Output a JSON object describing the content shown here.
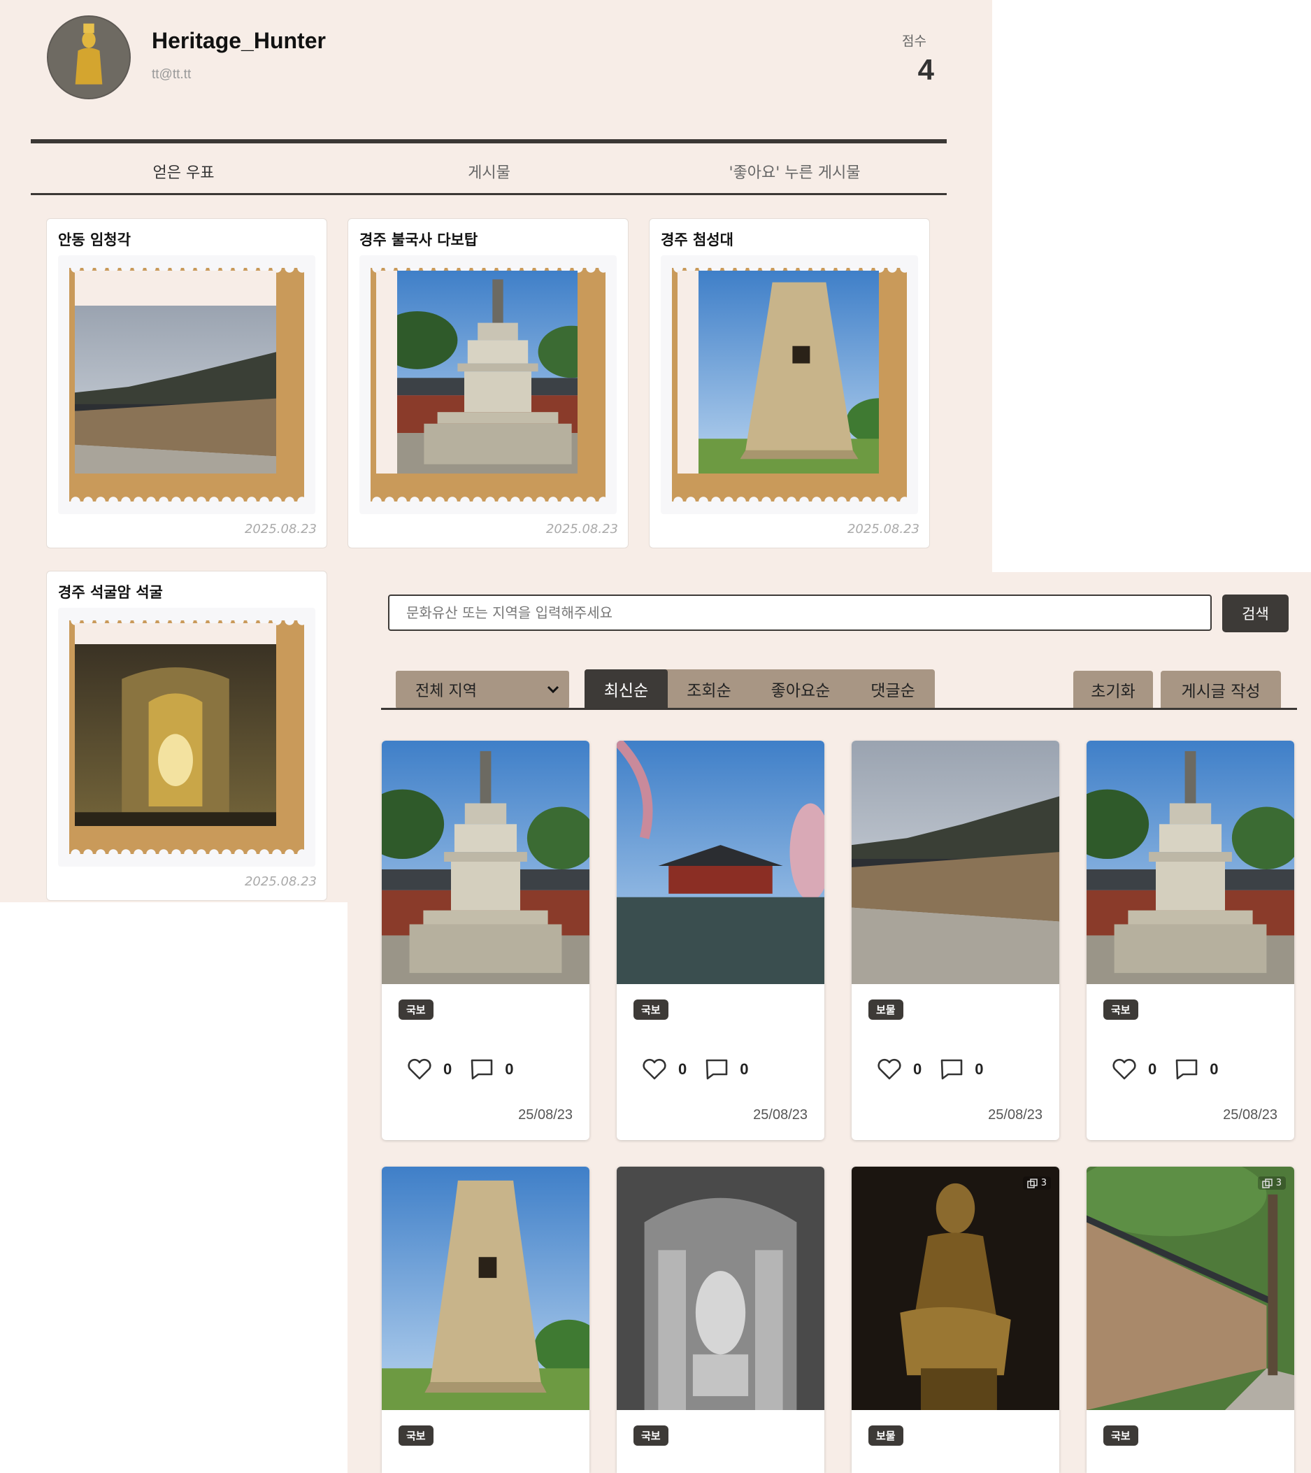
{
  "profile": {
    "username": "Heritage_Hunter",
    "email": "tt@tt.tt",
    "score_label": "점수",
    "score_value": "4",
    "tabs": [
      {
        "label": "얻은 우표",
        "active": true
      },
      {
        "label": "게시물",
        "active": false
      },
      {
        "label": "'좋아요' 누른 게시물",
        "active": false
      }
    ],
    "stamps": [
      {
        "title": "안동 임청각",
        "date": "2025.08.23",
        "image": "hanok-wall"
      },
      {
        "title": "경주 불국사 다보탑",
        "date": "2025.08.23",
        "image": "dabotap-pagoda"
      },
      {
        "title": "경주 첨성대",
        "date": "2025.08.23",
        "image": "cheomseongdae"
      },
      {
        "title": "경주 석굴암 석굴",
        "date": "2025.08.23",
        "image": "seokguram-grotto"
      }
    ]
  },
  "board": {
    "search": {
      "placeholder": "문화유산 또는 지역을 입력해주세요",
      "button_label": "검색"
    },
    "region_select": {
      "selected": "전체 지역"
    },
    "sort_tabs": [
      {
        "label": "최신순",
        "active": true
      },
      {
        "label": "조회순",
        "active": false
      },
      {
        "label": "좋아요순",
        "active": false
      },
      {
        "label": "댓글순",
        "active": false
      }
    ],
    "reset_label": "초기화",
    "write_label": "게시글 작성",
    "posts": [
      {
        "badge": "국보",
        "likes": "0",
        "comments": "0",
        "date": "25/08/23",
        "image": "dabotap-pagoda"
      },
      {
        "badge": "국보",
        "likes": "0",
        "comments": "0",
        "date": "25/08/23",
        "image": "gyeonghoeru-pavilion"
      },
      {
        "badge": "보물",
        "likes": "0",
        "comments": "0",
        "date": "25/08/23",
        "image": "hanok-wall"
      },
      {
        "badge": "국보",
        "likes": "0",
        "comments": "0",
        "date": "25/08/23",
        "image": "dabotap-pagoda"
      },
      {
        "badge": "국보",
        "image": "cheomseongdae"
      },
      {
        "badge": "국보",
        "image": "seokguram-grotto-bw"
      },
      {
        "badge": "보물",
        "image": "pensive-bodhisattva",
        "multi_count": "3"
      },
      {
        "badge": "국보",
        "image": "stone-wall-path",
        "multi_count": "3"
      }
    ]
  },
  "colors": {
    "panel_bg": "#f7ede7",
    "dark": "#3d3a37",
    "tab_tan": "#a89684",
    "stamp_gold": "#c99a5a"
  }
}
